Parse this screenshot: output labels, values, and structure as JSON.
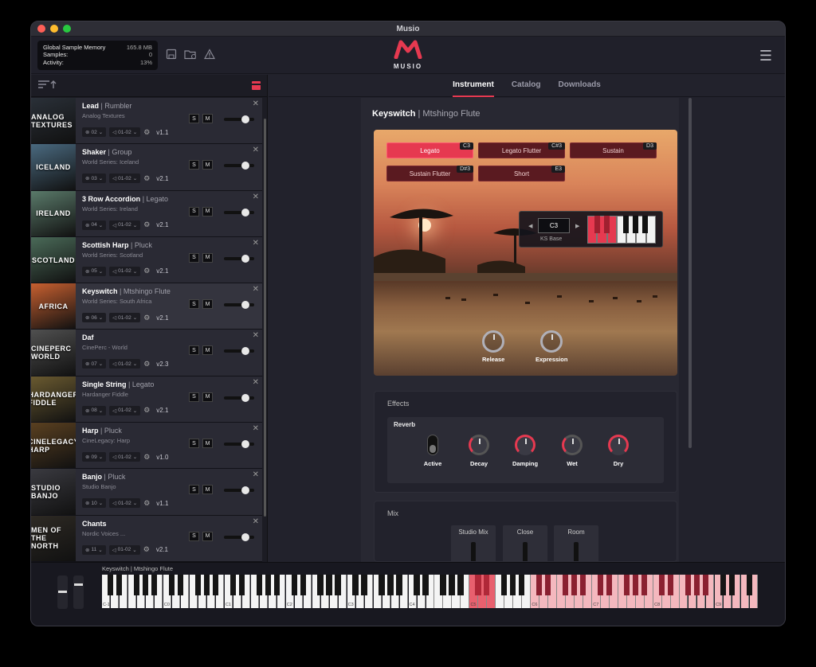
{
  "window": {
    "title": "Musio"
  },
  "memory": {
    "rows": [
      {
        "label": "Global Sample Memory",
        "value": "165.8 MB"
      },
      {
        "label": "Samples:",
        "value": "0"
      },
      {
        "label": "Activity:",
        "value": "13%"
      }
    ]
  },
  "logo": {
    "text": "MUSIO"
  },
  "tabs": [
    {
      "label": "Instrument",
      "selected": true
    },
    {
      "label": "Catalog",
      "selected": false
    },
    {
      "label": "Downloads",
      "selected": false
    }
  ],
  "instruments": [
    {
      "name": "Lead",
      "articulation": "Rumbler",
      "library": "Analog Textures",
      "channel": "02",
      "midi": "01-02",
      "version": "v1.1",
      "thumb": "ANALOG TEXTURES",
      "thumb_color": "#2a3038",
      "active": false
    },
    {
      "name": "Shaker",
      "articulation": "Group",
      "library": "World Series: Iceland",
      "channel": "03",
      "midi": "01-02",
      "version": "v2.1",
      "thumb": "ICELAND",
      "thumb_color": "#4a6a80",
      "active": false
    },
    {
      "name": "3 Row Accordion",
      "articulation": "Legato",
      "library": "World Series: Ireland",
      "channel": "04",
      "midi": "01-02",
      "version": "v2.1",
      "thumb": "IRELAND",
      "thumb_color": "#5a7a6a",
      "active": false
    },
    {
      "name": "Scottish Harp",
      "articulation": "Pluck",
      "library": "World Series: Scotland",
      "channel": "05",
      "midi": "01-02",
      "version": "v2.1",
      "thumb": "SCOTLAND",
      "thumb_color": "#4a6a58",
      "active": false
    },
    {
      "name": "Keyswitch",
      "articulation": "Mtshingo Flute",
      "library": "World Series: South Africa",
      "channel": "06",
      "midi": "01-02",
      "version": "v2.1",
      "thumb": "AFRICA",
      "thumb_color": "#c86030",
      "active": true
    },
    {
      "name": "Daf",
      "articulation": "",
      "library": "CinePerc - World",
      "channel": "07",
      "midi": "01-02",
      "version": "v2.3",
      "thumb": "CINEPERC WORLD",
      "thumb_color": "#505050",
      "active": false
    },
    {
      "name": "Single String",
      "articulation": "Legato",
      "library": "Hardanger Fiddle",
      "channel": "08",
      "midi": "01-02",
      "version": "v2.1",
      "thumb": "HARDANGER FIDDLE",
      "thumb_color": "#6a5a30",
      "active": false
    },
    {
      "name": "Harp",
      "articulation": "Pluck",
      "library": "CineLegacy: Harp",
      "channel": "09",
      "midi": "01-02",
      "version": "v1.0",
      "thumb": "CINELEGACY HARP",
      "thumb_color": "#5a4020",
      "active": false
    },
    {
      "name": "Banjo",
      "articulation": "Pluck",
      "library": "Studio Banjo",
      "channel": "10",
      "midi": "01-02",
      "version": "v1.1",
      "thumb": "STUDIO BANJO",
      "thumb_color": "#3a3a40",
      "active": false
    },
    {
      "name": "Chants",
      "articulation": "",
      "library": "Nordic Voices ...",
      "channel": "11",
      "midi": "01-02",
      "version": "v2.1",
      "thumb": "MEN OF THE NORTH",
      "thumb_color": "#2e2a24",
      "active": false
    }
  ],
  "sm_labels": {
    "solo": "S",
    "mute": "M"
  },
  "current": {
    "name": "Keyswitch",
    "articulation": "Mtshingo Flute"
  },
  "keyswitches": [
    {
      "label": "Legato",
      "note": "C3",
      "on": true
    },
    {
      "label": "Legato Flutter",
      "note": "C#3",
      "on": false
    },
    {
      "label": "Sustain",
      "note": "D3",
      "on": false
    },
    {
      "label": "Sustain Flutter",
      "note": "D#3",
      "on": false
    },
    {
      "label": "Short",
      "note": "E3",
      "on": false
    }
  ],
  "ks_base": {
    "value": "C3",
    "label": "KS Base"
  },
  "hero_knobs": [
    {
      "label": "Release"
    },
    {
      "label": "Expression"
    }
  ],
  "effects": {
    "title": "Effects",
    "reverb": {
      "title": "Reverb",
      "active_label": "Active",
      "knobs": [
        {
          "label": "Decay"
        },
        {
          "label": "Damping"
        },
        {
          "label": "Wet"
        },
        {
          "label": "Dry"
        }
      ]
    }
  },
  "mix": {
    "title": "Mix",
    "channels": [
      {
        "label": "Studio Mix"
      },
      {
        "label": "Close"
      },
      {
        "label": "Room"
      }
    ]
  },
  "keyboard": {
    "label": "Keyswitch | Mtshingo Flute",
    "octaves": [
      "C-1",
      "C0",
      "C1",
      "C2",
      "C3",
      "C4",
      "C5",
      "C6",
      "C7",
      "C8",
      "C9"
    ]
  },
  "colors": {
    "accent": "#e63950",
    "ks_range": "#e63950",
    "play_range": "#f0a0a8"
  }
}
